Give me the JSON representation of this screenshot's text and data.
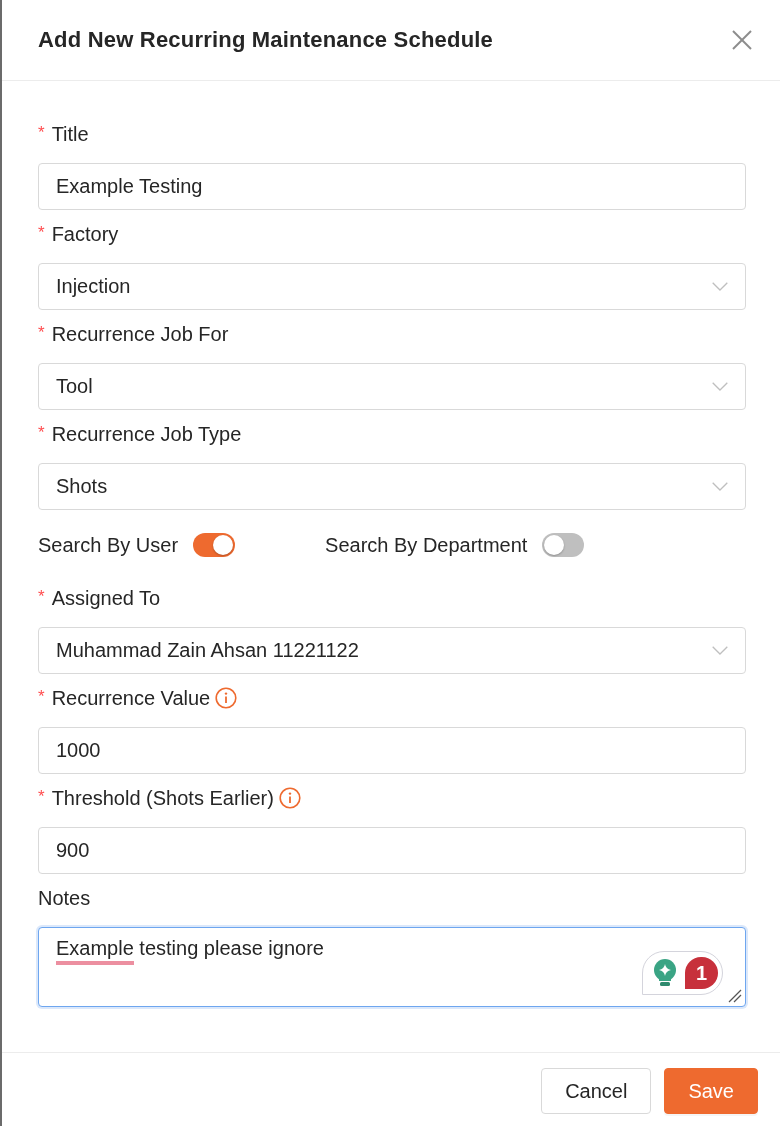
{
  "dialog": {
    "title": "Add New Recurring Maintenance Schedule"
  },
  "form_items": [
    {
      "kind": "text",
      "label": "Title",
      "required_mark": "*",
      "info_icon": false,
      "value": "Example Testing"
    },
    {
      "kind": "select",
      "label": "Factory",
      "required_mark": "*",
      "info_icon": false,
      "value": "Injection"
    },
    {
      "kind": "select",
      "label": "Recurrence Job For",
      "required_mark": "*",
      "info_icon": false,
      "value": "Tool"
    },
    {
      "kind": "select",
      "label": "Recurrence Job Type",
      "required_mark": "*",
      "info_icon": false,
      "value": "Shots"
    },
    {
      "kind": "toggle_row",
      "toggles": [
        {
          "label": "Search By User",
          "on": true
        },
        {
          "label": "Search By Department",
          "on": false
        }
      ]
    },
    {
      "kind": "select",
      "label": "Assigned To",
      "required_mark": "*",
      "info_icon": false,
      "value": "Muhammad Zain Ahsan 11221122"
    },
    {
      "kind": "text",
      "label": "Recurrence Value",
      "required_mark": "*",
      "info_icon": true,
      "value": "1000"
    },
    {
      "kind": "text",
      "label": "Threshold (Shots Earlier)",
      "required_mark": "*",
      "info_icon": true,
      "value": "900"
    },
    {
      "kind": "textarea",
      "label": "Notes",
      "info_icon": false,
      "focused": true,
      "value_segments": [
        {
          "text": "Example",
          "misspelled": true
        },
        {
          "text": " testing please ignore",
          "misspelled": false
        }
      ],
      "assistant": {
        "count": "1"
      }
    }
  ],
  "footer": {
    "buttons": [
      {
        "label": "Cancel",
        "kind": "secondary"
      },
      {
        "label": "Save",
        "kind": "primary"
      }
    ]
  }
}
